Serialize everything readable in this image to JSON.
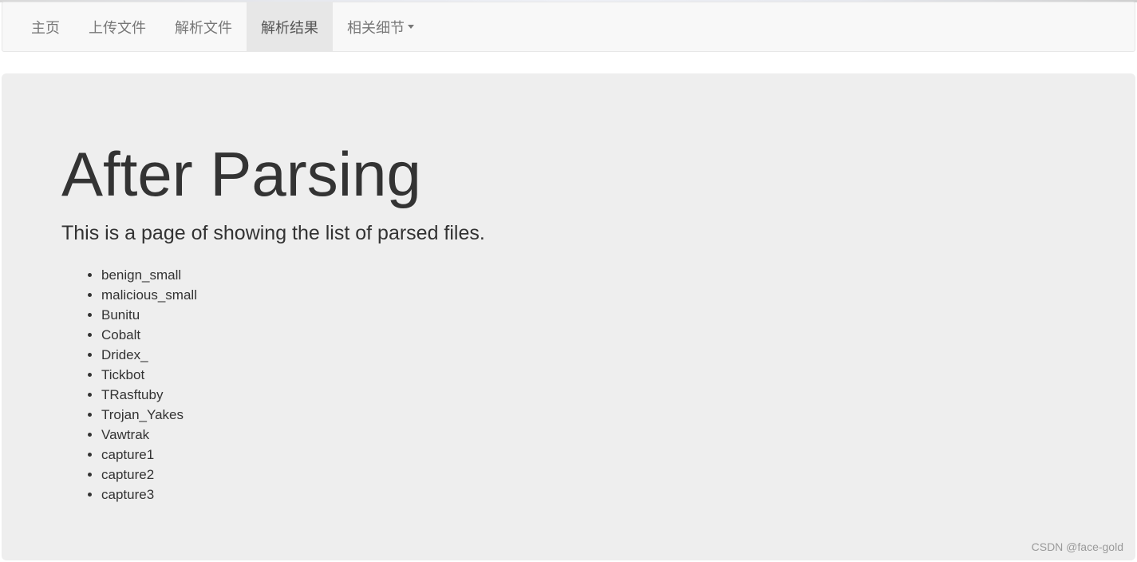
{
  "nav": {
    "items": [
      {
        "label": "主页"
      },
      {
        "label": "上传文件"
      },
      {
        "label": "解析文件"
      },
      {
        "label": "解析结果"
      },
      {
        "label": "相关细节"
      }
    ]
  },
  "main": {
    "title": "After Parsing",
    "lead": "This is a page of showing the list of parsed files.",
    "files": [
      "benign_small",
      "malicious_small",
      "Bunitu",
      "Cobalt",
      "Dridex_",
      "Tickbot",
      "TRasftuby",
      "Trojan_Yakes",
      "Vawtrak",
      "capture1",
      "capture2",
      "capture3"
    ]
  },
  "watermark": "CSDN @face-gold"
}
